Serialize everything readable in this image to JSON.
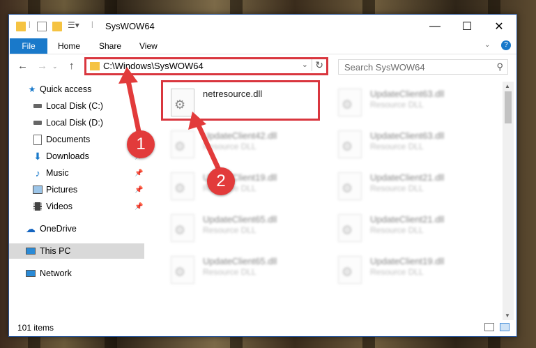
{
  "window": {
    "title": "SysWOW64",
    "controls": {
      "minimize": "—",
      "maximize": "☐",
      "close": "✕"
    }
  },
  "ribbon": {
    "tabs": [
      "File",
      "Home",
      "Share",
      "View"
    ]
  },
  "address": {
    "path": "C:\\Windows\\SysWOW64",
    "search_placeholder": "Search SysWOW64"
  },
  "sidebar": {
    "items": [
      {
        "label": "Quick access",
        "icon": "star-icon"
      },
      {
        "label": "Local Disk (C:)",
        "icon": "drive-icon"
      },
      {
        "label": "Local Disk (D:)",
        "icon": "drive-icon"
      },
      {
        "label": "Documents",
        "icon": "documents-icon"
      },
      {
        "label": "Downloads",
        "icon": "download-icon"
      },
      {
        "label": "Music",
        "icon": "music-icon"
      },
      {
        "label": "Pictures",
        "icon": "pictures-icon"
      },
      {
        "label": "Videos",
        "icon": "videos-icon"
      },
      {
        "label": "OneDrive",
        "icon": "cloud-icon"
      },
      {
        "label": "This PC",
        "icon": "computer-icon"
      },
      {
        "label": "Network",
        "icon": "network-icon"
      }
    ]
  },
  "files": [
    {
      "name": "netresource.dll",
      "type": ""
    },
    {
      "name": "UpdateClient63.dll",
      "type": "Resource DLL"
    },
    {
      "name": "UpdateClient42.dll",
      "type": "Resource DLL"
    },
    {
      "name": "UpdateClient63.dll",
      "type": "Resource DLL"
    },
    {
      "name": "UpdateClient19.dll",
      "type": "Resource DLL"
    },
    {
      "name": "UpdateClient21.dll",
      "type": "Resource DLL"
    },
    {
      "name": "UpdateClient65.dll",
      "type": "Resource DLL"
    },
    {
      "name": "UpdateClient21.dll",
      "type": "Resource DLL"
    },
    {
      "name": "UpdateClient65.dll",
      "type": "Resource DLL"
    },
    {
      "name": "UpdateClient19.dll",
      "type": "Resource DLL"
    }
  ],
  "status": {
    "count": "101 items"
  },
  "annotations": {
    "step1": "1",
    "step2": "2"
  },
  "colors": {
    "accent": "#1979ca",
    "highlight": "#d9363e"
  }
}
